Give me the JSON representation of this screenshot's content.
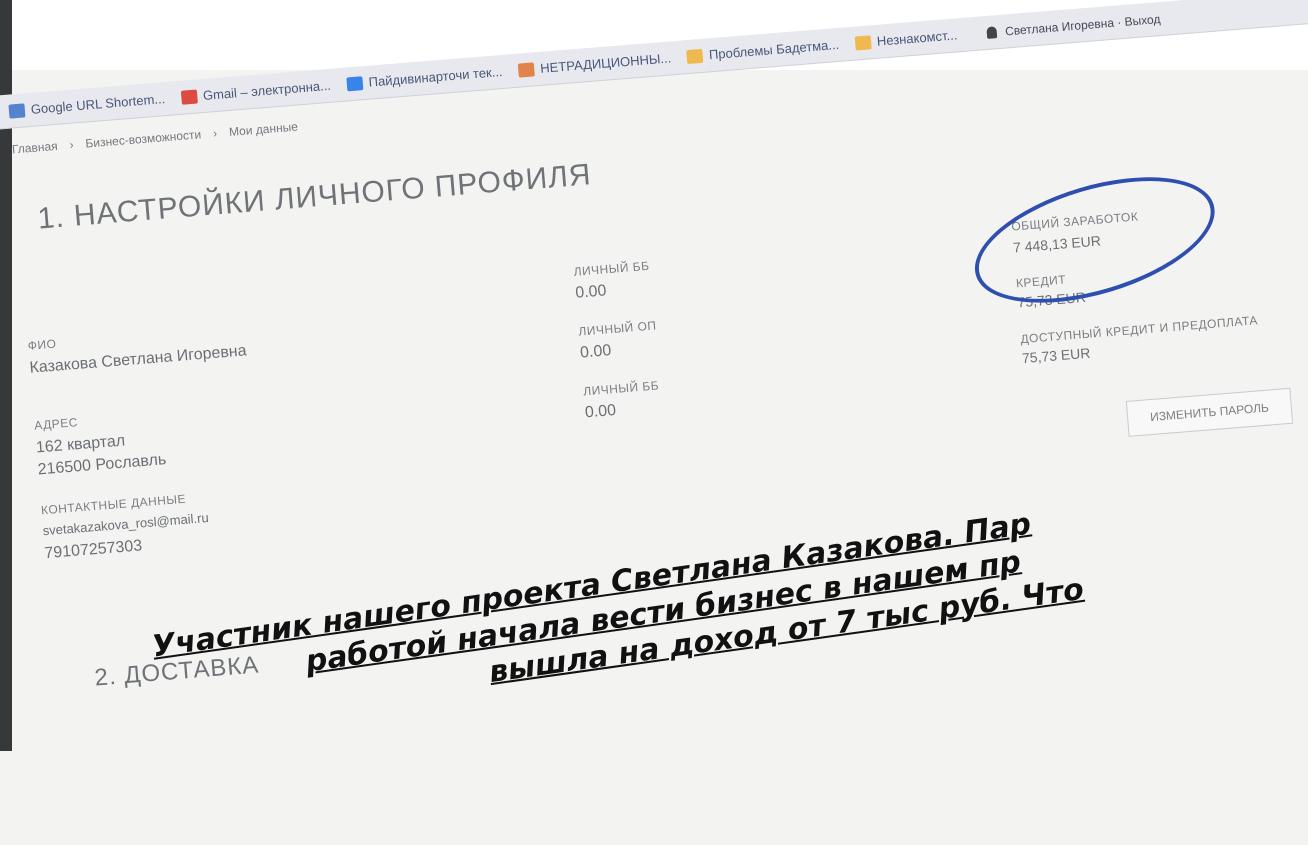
{
  "browser": {
    "bookmarks": [
      {
        "label": "Google URL Shortem...",
        "icon": "google-shortener-icon",
        "color": "#3b73c9"
      },
      {
        "label": "Gmail – электронна...",
        "icon": "gmail-icon",
        "color": "#d93025"
      },
      {
        "label": "Пайдивинарточи тек...",
        "icon": "translator-icon",
        "color": "#1a73e8"
      },
      {
        "label": "НЕТРАДИЦИОННЫ...",
        "icon": "bookmark-icon",
        "color": "#e0722e"
      },
      {
        "label": "Проблемы Бадетма...",
        "icon": "bookmark-icon",
        "color": "#f2b134"
      },
      {
        "label": "Незнакомст...",
        "icon": "bookmark-icon",
        "color": "#f2b134"
      }
    ],
    "user_label": "Светлана Игоревна · Выход"
  },
  "breadcrumbs": [
    "Главная",
    "Бизнес-возможности",
    "Мои данные"
  ],
  "page": {
    "title": "1. НАСТРОЙКИ ЛИЧНОГО ПРОФИЛЯ",
    "section2": "2. ДОСТАВКА"
  },
  "profile": {
    "name_label": "ФИО",
    "name_value": "Казакова Светлана Игоревна",
    "address_label": "АДРЕС",
    "address_lines": [
      "162 квартал",
      "216500 Рославль"
    ],
    "contacts_label": "КОНТАКТНЫЕ ДАННЫЕ",
    "email": "svetakazakova_rosl@mail.ru",
    "phone": "79107257303"
  },
  "points": [
    {
      "label": "ЛИЧНЫЙ ББ",
      "value": "0.00"
    },
    {
      "label": "ЛИЧНЫЙ ОП",
      "value": "0.00"
    },
    {
      "label": "ЛИЧНЫЙ ББ",
      "value": "0.00"
    }
  ],
  "summary": {
    "total_label": "ОБЩИЙ ЗАРАБОТОК",
    "total_value": "7 448,13 EUR",
    "second_label": "КРЕДИТ",
    "second_value": "75,73 EUR",
    "third_label": "ДОСТУПНЫЙ КРЕДИТ И ПРЕДОПЛАТА",
    "third_value": "75,73 EUR",
    "button_label": "ИЗМЕНИТЬ ПАРОЛЬ"
  },
  "caption": {
    "line1": "Участник нашего проекта Светлана Казакова. Пар",
    "line2": "работой начала вести бизнес в нашем пр",
    "line3": "вышла на доход от 7 тыс руб. Что"
  }
}
